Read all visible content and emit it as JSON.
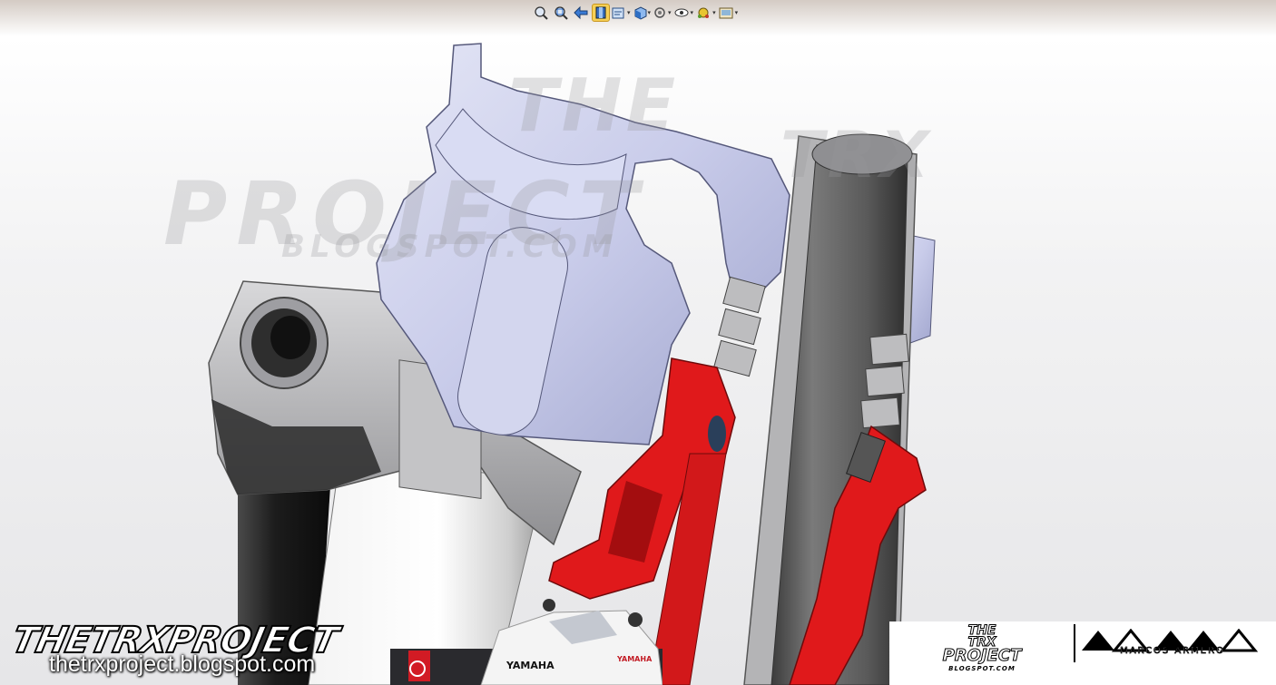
{
  "toolbar": {
    "buttons": [
      {
        "name": "zoom-to-fit",
        "icon": "zoom-fit-icon",
        "dropdown": false
      },
      {
        "name": "zoom-to-area",
        "icon": "zoom-area-icon",
        "dropdown": false
      },
      {
        "name": "previous-view",
        "icon": "previous-view-icon",
        "dropdown": false
      },
      {
        "name": "section-view",
        "icon": "section-view-icon",
        "dropdown": false,
        "active": true
      },
      {
        "name": "dynamic-annotation",
        "icon": "annotation-icon",
        "dropdown": true
      },
      {
        "name": "view-orientation",
        "icon": "cube-view-icon",
        "dropdown": true
      },
      {
        "name": "display-style",
        "icon": "display-style-icon",
        "dropdown": true
      },
      {
        "name": "hide-show-items",
        "icon": "eye-icon",
        "dropdown": true
      },
      {
        "name": "edit-appearance",
        "icon": "appearance-icon",
        "dropdown": true
      },
      {
        "name": "apply-scene",
        "icon": "scene-icon",
        "dropdown": true
      }
    ]
  },
  "watermark": {
    "line1": "THE",
    "line2": "TRX",
    "line3": "PROJECT",
    "line4": "BLOGSPOT.COM"
  },
  "footer": {
    "logo_text": "THETRXPROJECT",
    "blog_url": "thetrxproject.blogspot.com",
    "brand_badge": "YAMAHA",
    "right_logo_line1": "THE",
    "right_logo_line2": "TRX",
    "right_logo_line3": "PROJECT",
    "right_logo_sub": "BLOGSPOT.COM",
    "author_name": "MARCOS ARMERO"
  },
  "colors": {
    "part_gray": "#b9b9bc",
    "part_lavender": "#c7cbe9",
    "part_red": "#e0191b",
    "part_dark": "#2a2a2a",
    "active_button": "#f6cf55"
  }
}
